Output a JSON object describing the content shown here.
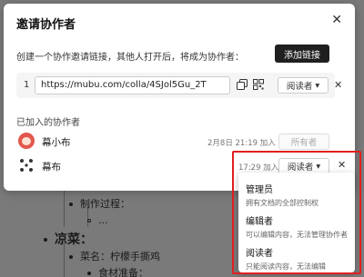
{
  "dialog": {
    "title": "邀请协作者",
    "description": "创建一个协作邀请链接，其他人打开后，将成为协作者：",
    "add_link_label": "添加链接"
  },
  "link": {
    "index": "1",
    "url": "https://mubu.com/colla/4SJol5Gu_2T",
    "role": "阅读者"
  },
  "joined": {
    "title": "已加入的协作者",
    "members": [
      {
        "name": "幕小布",
        "meta": "2月8日 21:19 加入",
        "role": "所有者"
      },
      {
        "name": "幕布",
        "meta": "17:29 加入",
        "role": "阅读者"
      }
    ]
  },
  "dropdown": {
    "options": [
      {
        "title": "管理员",
        "desc": "拥有文档的全部控制权"
      },
      {
        "title": "编辑者",
        "desc": "可以编辑内容，无法管理协作者"
      },
      {
        "title": "阅读者",
        "desc": "只能阅读内容，无法编辑"
      }
    ]
  },
  "document": {
    "lines": [
      {
        "text": "制作过程："
      },
      {
        "text": "..."
      },
      {
        "text": "凉菜："
      },
      {
        "text": "菜名：柠檬手撕鸡"
      },
      {
        "text": "食材准备："
      }
    ]
  },
  "colors": {
    "accent_button": "#1f1f1f",
    "highlight": "#e02020"
  }
}
